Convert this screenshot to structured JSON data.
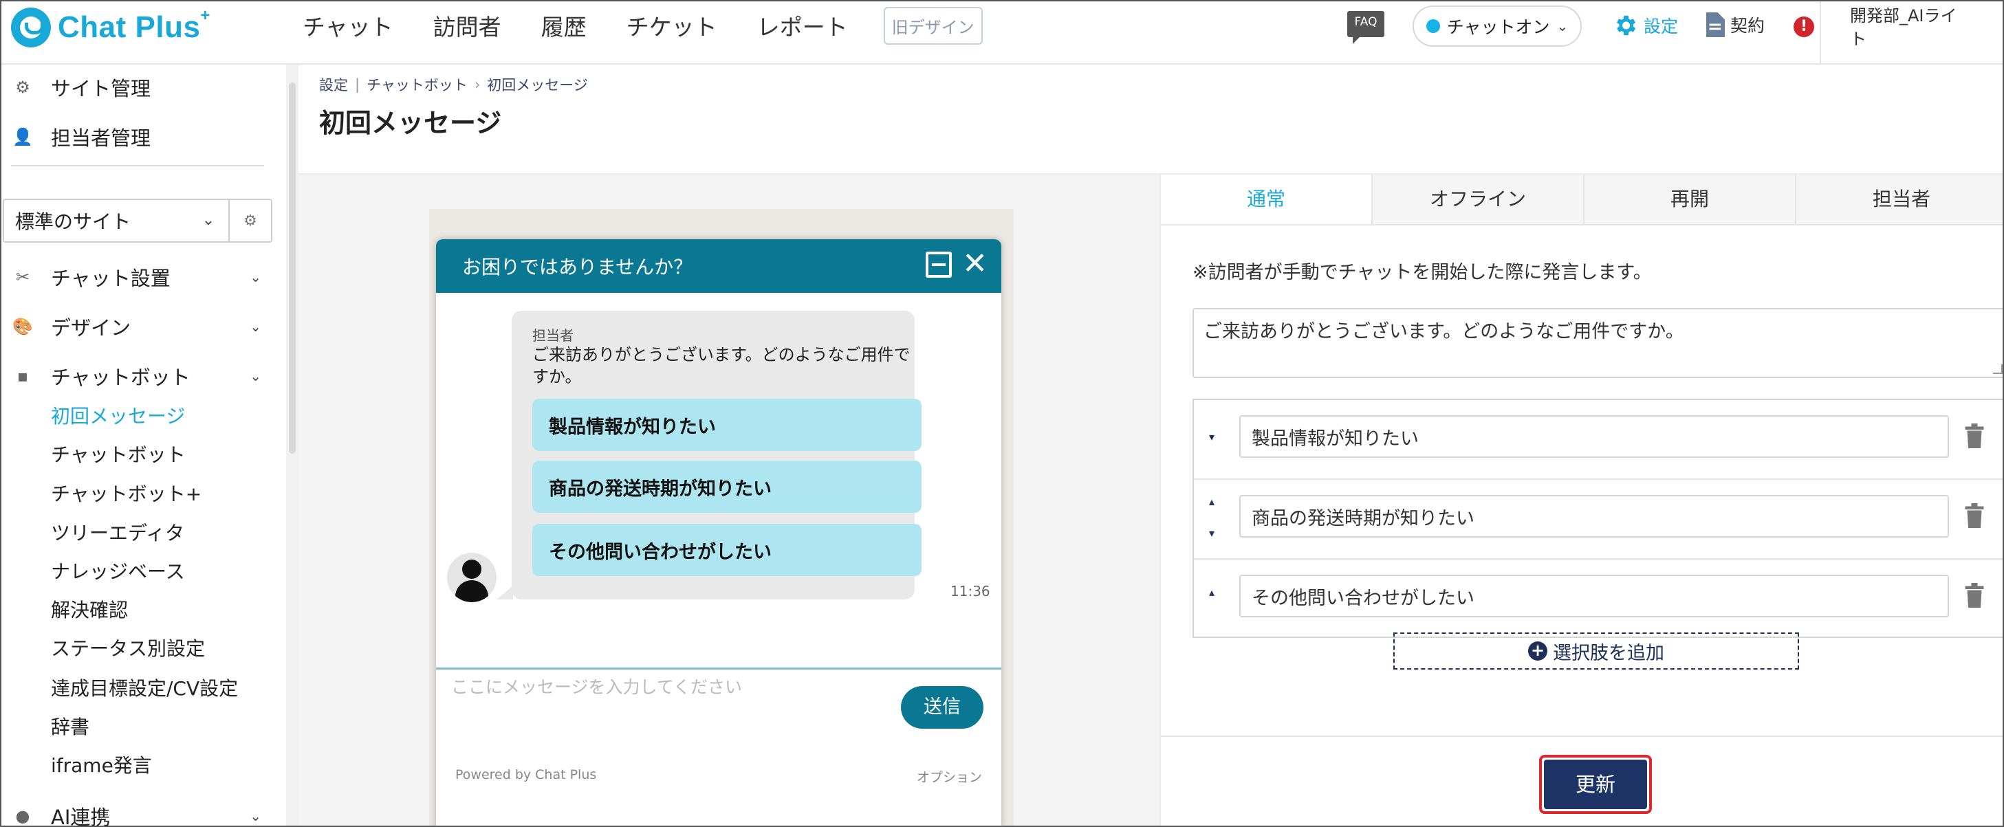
{
  "app": {
    "logo_text": "Chat Plus",
    "logo_plus": "+",
    "nav": [
      "チャット",
      "訪問者",
      "履歴",
      "チケット",
      "レポート"
    ],
    "old_design": "旧デザイン",
    "faq": "FAQ",
    "status": "チャットオン",
    "settings": "設定",
    "contract": "契約",
    "alert": "!",
    "user_name": "開発部_AIライト",
    "accent_color": "#18a9d8",
    "chat_header_color": "#0b7893",
    "button_color": "#1f3466"
  },
  "sidebar": {
    "top_items": [
      {
        "label": "サイト管理",
        "icon": "gear-icon"
      },
      {
        "label": "担当者管理",
        "icon": "users-icon"
      }
    ],
    "site_select": "標準のサイト",
    "sections": [
      {
        "label": "チャット設置",
        "icon": "tools-icon"
      },
      {
        "label": "デザイン",
        "icon": "palette-icon"
      },
      {
        "label": "チャットボット",
        "icon": "chat-icon"
      }
    ],
    "sub_items": [
      "初回メッセージ",
      "チャットボット",
      "チャットボット+",
      "ツリーエディタ",
      "ナレッジベース",
      "解決確認",
      "ステータス別設定",
      "達成目標設定/CV設定",
      "辞書",
      "iframe発言"
    ],
    "active_sub": "初回メッセージ",
    "bottom_section": {
      "label": "AI連携",
      "icon": "bulb-icon"
    }
  },
  "page": {
    "breadcrumb": [
      "設定",
      "チャットボット",
      "初回メッセージ"
    ],
    "title": "初回メッセージ"
  },
  "preview": {
    "header_title": "お困りではありませんか？",
    "sender": "担当者",
    "message": "ご来訪ありがとうございます。どのようなご用件ですか。",
    "choices": [
      "製品情報が知りたい",
      "商品の発送時期が知りたい",
      "その他問い合わせがしたい"
    ],
    "time": "11:36",
    "input_placeholder": "ここにメッセージを入力してください",
    "send_label": "送信",
    "powered_by": "Powered by Chat Plus",
    "option_label": "オプション"
  },
  "panel": {
    "tabs": [
      "通常",
      "オフライン",
      "再開",
      "担当者"
    ],
    "active_tab": "通常",
    "note": "※訪問者が手動でチャットを開始した際に発言します。",
    "message_value": "ご来訪ありがとうございます。どのようなご用件ですか。",
    "choices": [
      "製品情報が知りたい",
      "商品の発送時期が知りたい",
      "その他問い合わせがしたい"
    ],
    "add_choice_label": "選択肢を追加",
    "update_label": "更新"
  }
}
